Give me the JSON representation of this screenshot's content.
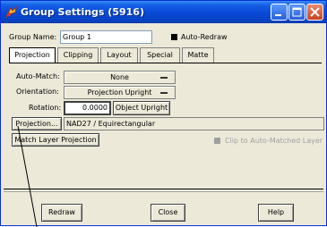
{
  "window": {
    "title": "Group Settings (5916)"
  },
  "group": {
    "name_label": "Group Name:",
    "name_value": "Group 1",
    "auto_redraw_label": "Auto-Redraw"
  },
  "tabs": [
    {
      "label": "Projection"
    },
    {
      "label": "Clipping"
    },
    {
      "label": "Layout"
    },
    {
      "label": "Special"
    },
    {
      "label": "Matte"
    }
  ],
  "projection": {
    "auto_match_label": "Auto-Match:",
    "auto_match_value": "None",
    "orientation_label": "Orientation:",
    "orientation_value": "Projection Upright",
    "rotation_label": "Rotation:",
    "rotation_value": "0.0000",
    "object_upright_label": "Object Upright",
    "projection_button_label": "Projection...",
    "projection_value": "NAD27 / Equirectangular",
    "match_layer_label": "Match Layer Projection",
    "clip_label": "Clip to Auto-Matched Layer"
  },
  "footer": {
    "redraw_label": "Redraw",
    "close_label": "Close",
    "help_label": "Help"
  },
  "colors": {
    "titlebar": "#0a4bd9",
    "face": "#ece9d8",
    "disabled_text": "#a0a0a0"
  }
}
